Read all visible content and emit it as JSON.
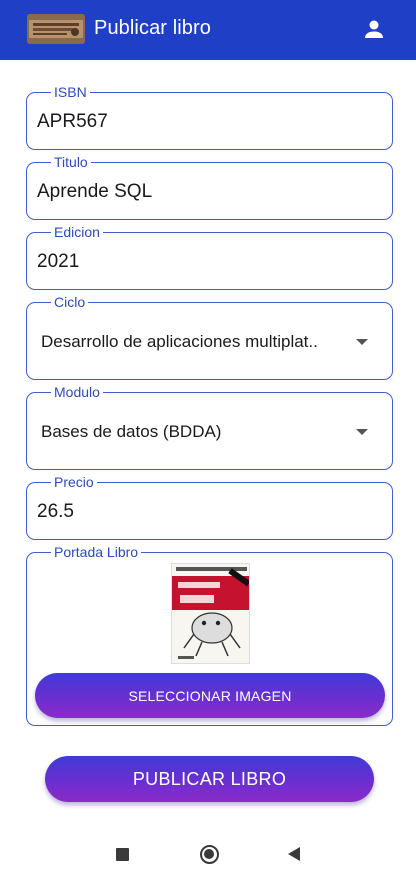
{
  "appbar": {
    "title": "Publicar libro",
    "logo_icon": "book-logo",
    "account_icon": "account-icon",
    "color": "#1f3fc7"
  },
  "form": {
    "isbn": {
      "label": "ISBN",
      "value": "APR567"
    },
    "titulo": {
      "label": "Titulo",
      "value": "Aprende SQL"
    },
    "edicion": {
      "label": "Edicion",
      "value": "2021"
    },
    "ciclo": {
      "label": "Ciclo",
      "value": "Desarrollo de aplicaciones multiplat.."
    },
    "modulo": {
      "label": "Modulo",
      "value": "Bases de datos (BDDA)"
    },
    "precio": {
      "label": "Precio",
      "value": "26.5"
    },
    "portada": {
      "label": "Portada Libro",
      "cover_icon": "book-cover-image"
    }
  },
  "buttons": {
    "select_image": "SELECCIONAR IMAGEN",
    "publish": "PUBLICAR LIBRO"
  },
  "navbar": {
    "icons": [
      "recents-icon",
      "home-icon",
      "back-icon"
    ]
  },
  "colors": {
    "accent": "#3f5ecf",
    "button_gradient_start": "#3f3bd6",
    "button_gradient_end": "#8a2bc8"
  }
}
